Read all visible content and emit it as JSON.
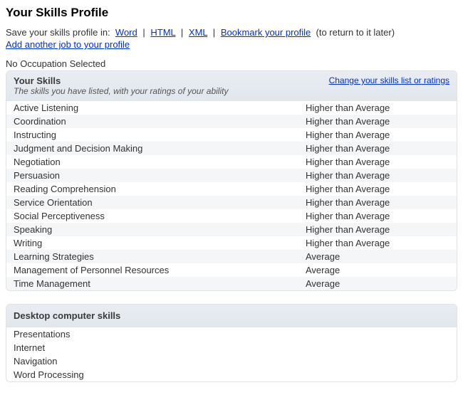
{
  "page_title": "Your Skills Profile",
  "save_line": {
    "prefix": "Save your skills profile in:",
    "formats": [
      "Word",
      "HTML",
      "XML"
    ],
    "bookmark": "Bookmark your profile",
    "trailing": "(to return to it later)"
  },
  "add_job_link": "Add another job to your profile",
  "no_occupation": "No Occupation Selected",
  "skills_panel": {
    "title": "Your Skills",
    "subtitle": "The skills you have listed, with your ratings of your ability",
    "change_link": "Change your skills list or ratings",
    "rows": [
      {
        "name": "Active Listening",
        "rating": "Higher than Average"
      },
      {
        "name": "Coordination",
        "rating": "Higher than Average"
      },
      {
        "name": "Instructing",
        "rating": "Higher than Average"
      },
      {
        "name": "Judgment and Decision Making",
        "rating": "Higher than Average"
      },
      {
        "name": "Negotiation",
        "rating": "Higher than Average"
      },
      {
        "name": "Persuasion",
        "rating": "Higher than Average"
      },
      {
        "name": "Reading Comprehension",
        "rating": "Higher than Average"
      },
      {
        "name": "Service Orientation",
        "rating": "Higher than Average"
      },
      {
        "name": "Social Perceptiveness",
        "rating": "Higher than Average"
      },
      {
        "name": "Speaking",
        "rating": "Higher than Average"
      },
      {
        "name": "Writing",
        "rating": "Higher than Average"
      },
      {
        "name": "Learning Strategies",
        "rating": "Average"
      },
      {
        "name": "Management of Personnel Resources",
        "rating": "Average"
      },
      {
        "name": "Time Management",
        "rating": "Average"
      }
    ]
  },
  "desktop_panel": {
    "title": "Desktop computer skills",
    "items": [
      "Presentations",
      "Internet",
      "Navigation",
      "Word Processing"
    ]
  }
}
